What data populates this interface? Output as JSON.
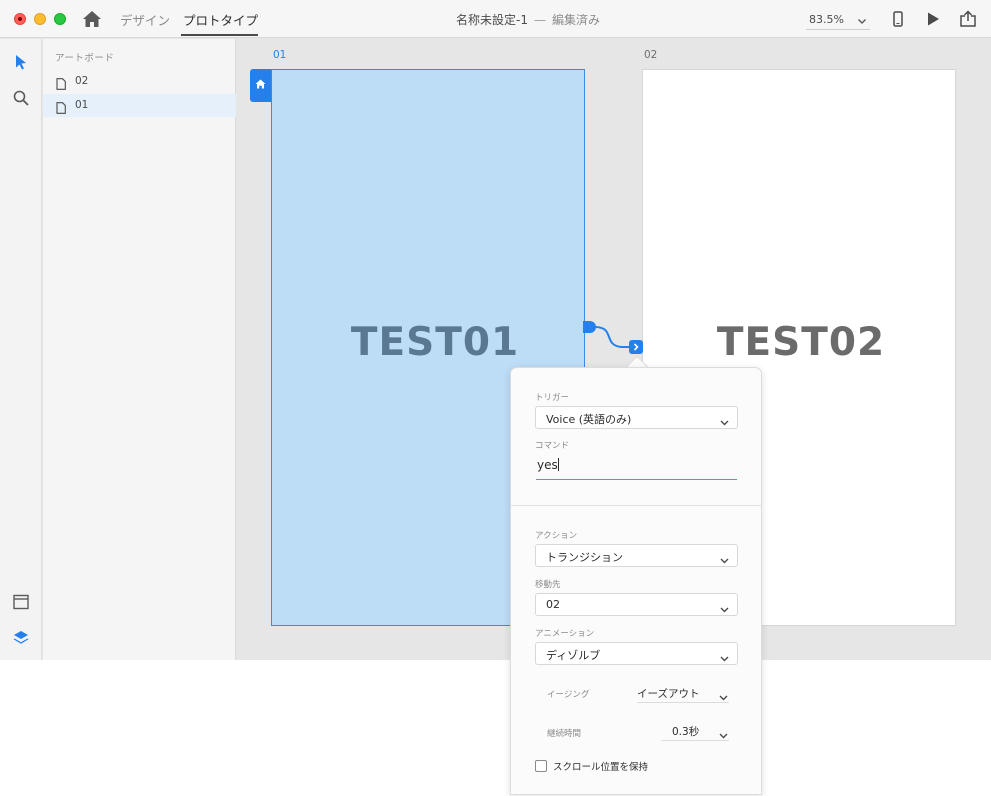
{
  "titlebar": {
    "tabs": [
      {
        "label": "デザイン",
        "active": false
      },
      {
        "label": "プロトタイプ",
        "active": true
      }
    ],
    "doc_title": "名称未設定-1",
    "doc_separator": "—",
    "doc_status": "編集済み",
    "zoom": "83.5%",
    "icons": [
      "home-icon",
      "mobile-device-icon",
      "play-icon",
      "share-icon"
    ]
  },
  "toolbar": {
    "tools": [
      "select-arrow-icon",
      "zoom-search-icon",
      "assets-icon",
      "layers-icon"
    ],
    "accent_color": "#2680eb"
  },
  "layers": {
    "header": "アートボード",
    "items": [
      {
        "label": "02",
        "selected": false
      },
      {
        "label": "01",
        "selected": true
      }
    ]
  },
  "canvas": {
    "artboards": [
      {
        "label": "01",
        "text": "TEST01",
        "selected": true,
        "fill": "#bddcf6"
      },
      {
        "label": "02",
        "text": "TEST02",
        "selected": false,
        "fill": "#ffffff"
      }
    ]
  },
  "popover": {
    "trigger_label": "トリガー",
    "trigger_value": "Voice (英語のみ)",
    "command_label": "コマンド",
    "command_value": "yes",
    "action_label": "アクション",
    "action_value": "トランジション",
    "destination_label": "移動先",
    "destination_value": "02",
    "animation_label": "アニメーション",
    "animation_value": "ディゾルブ",
    "easing_label": "イージング",
    "easing_value": "イーズアウト",
    "duration_label": "継続時間",
    "duration_value": "0.3秒",
    "preserve_scroll_label": "スクロール位置を保持",
    "preserve_scroll_checked": false
  }
}
